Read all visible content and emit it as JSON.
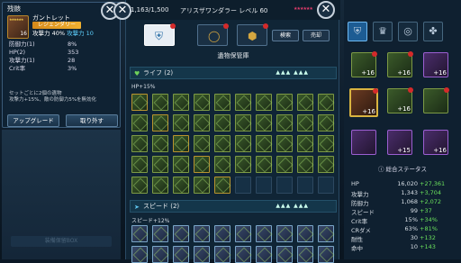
{
  "tooltip": {
    "title": "残骸",
    "item_name": "ガントレット",
    "item_level": "16",
    "rarity": "レジェンダリー",
    "main_stat_label": "攻撃力 40%",
    "main_stat_extra": "攻撃力 10",
    "stats": [
      {
        "label": "防御力(1)",
        "value": "8%"
      },
      {
        "label": "HP(2)",
        "value": "353"
      },
      {
        "label": "攻撃力(1)",
        "value": "28"
      },
      {
        "label": "Crit率",
        "value": "3%"
      }
    ],
    "set_line1": "セットごとに2個の遺物",
    "set_line2": "攻撃力+15%、敵の防御力5%を無効化",
    "upgrade_label": "アップグレード",
    "remove_label": "取り外す",
    "faded_label": "装備保留BOX"
  },
  "center": {
    "count": "1,163/1,500",
    "hero": "アリスザワンダラー レベル 60",
    "search_label": "検索",
    "sell_label": "売却",
    "title": "遺物保管庫",
    "section1_title": "ライフ (2)",
    "section1_sub": "HP+15%",
    "section2_title": "スピード (2)",
    "section2_sub": "スピード+12%",
    "arrows": "▲▲▲   ▲▲▲"
  },
  "right": {
    "items_plus": [
      "+16",
      "+16",
      "+16",
      "+16",
      "+16",
      "+15",
      "+16"
    ],
    "stats_title": "総合ステータス",
    "stats": [
      {
        "k": "HP",
        "v": "16,020",
        "b": "+27,361"
      },
      {
        "k": "攻撃力",
        "v": "1,343",
        "b": "+3,704"
      },
      {
        "k": "防御力",
        "v": "1,068",
        "b": "+2,072"
      },
      {
        "k": "スピード",
        "v": "99",
        "b": "+37"
      },
      {
        "k": "Crit率",
        "v": "15%",
        "b": "+34%"
      },
      {
        "k": "CRダメ",
        "v": "63%",
        "b": "+81%"
      },
      {
        "k": "耐性",
        "v": "30",
        "b": "+132"
      },
      {
        "k": "命中",
        "v": "10",
        "b": "+143"
      }
    ]
  },
  "colors": {
    "accent": "#1d5c93",
    "legendary": "#e8a020",
    "bonus": "#6ae05c"
  }
}
